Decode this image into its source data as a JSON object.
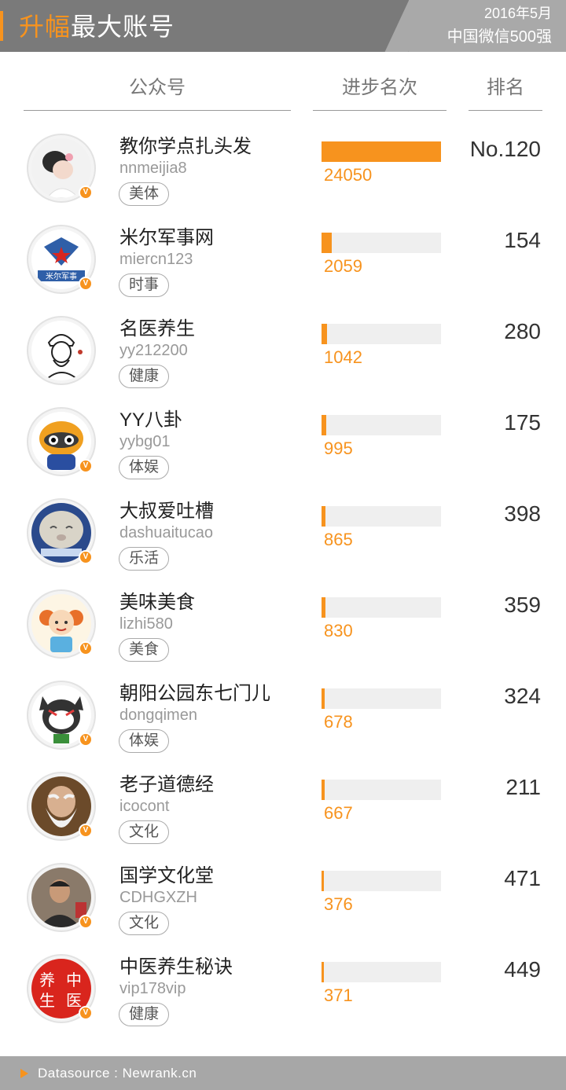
{
  "header": {
    "title_highlight": "升幅",
    "title_rest": "最大账号",
    "date": "2016年5月",
    "subtitle": "中国微信500强"
  },
  "columns": {
    "account": "公众号",
    "progress": "进步名次",
    "rank": "排名"
  },
  "chart_data": {
    "type": "bar",
    "orientation": "horizontal",
    "xlim": [
      0,
      24050
    ],
    "categories": [
      "教你学点扎头发",
      "米尔军事网",
      "名医养生",
      "YY八卦",
      "大叔爱吐槽",
      "美味美食",
      "朝阳公园东七门儿",
      "老子道德经",
      "国学文化堂",
      "中医养生秘诀"
    ],
    "values": [
      24050,
      2059,
      1042,
      995,
      865,
      830,
      678,
      667,
      376,
      371
    ],
    "bar_color": "#f7931e",
    "track_color": "#efefef"
  },
  "rows": [
    {
      "name": "教你学点扎头发",
      "handle": "nnmeijia8",
      "tag": "美体",
      "progress": 24050,
      "rank": "No.120",
      "avatar_icon": "girl-hairstyle-icon"
    },
    {
      "name": "米尔军事网",
      "handle": "miercn123",
      "tag": "时事",
      "progress": 2059,
      "rank": "154",
      "avatar_icon": "military-logo-icon"
    },
    {
      "name": "名医养生",
      "handle": "yy212200",
      "tag": "健康",
      "progress": 1042,
      "rank": "280",
      "avatar_icon": "ink-portrait-icon"
    },
    {
      "name": "YY八卦",
      "handle": "yybg01",
      "tag": "体娱",
      "progress": 995,
      "rank": "175",
      "avatar_icon": "raccoon-cartoon-icon"
    },
    {
      "name": "大叔爱吐槽",
      "handle": "dashuaitucao",
      "tag": "乐活",
      "progress": 865,
      "rank": "398",
      "avatar_icon": "cat-face-icon"
    },
    {
      "name": "美味美食",
      "handle": "lizhi580",
      "tag": "美食",
      "progress": 830,
      "rank": "359",
      "avatar_icon": "cartoon-girl-icon"
    },
    {
      "name": "朝阳公园东七门儿",
      "handle": "dongqimen",
      "tag": "体娱",
      "progress": 678,
      "rank": "324",
      "avatar_icon": "opera-cat-icon"
    },
    {
      "name": "老子道德经",
      "handle": "icocont",
      "tag": "文化",
      "progress": 667,
      "rank": "211",
      "avatar_icon": "sage-portrait-icon"
    },
    {
      "name": "国学文化堂",
      "handle": "CDHGXZH",
      "tag": "文化",
      "progress": 376,
      "rank": "471",
      "avatar_icon": "man-portrait-icon"
    },
    {
      "name": "中医养生秘诀",
      "handle": "vip178vip",
      "tag": "健康",
      "progress": 371,
      "rank": "449",
      "avatar_icon": "tcm-characters-icon"
    }
  ],
  "badge": {
    "verified_letter": "V",
    "color": "#f7931e"
  },
  "avatar_text": {
    "military": "米尔军事",
    "tcm": [
      "养",
      "中",
      "生",
      "医"
    ]
  },
  "footer": {
    "source": "Datasource : Newrank.cn"
  }
}
